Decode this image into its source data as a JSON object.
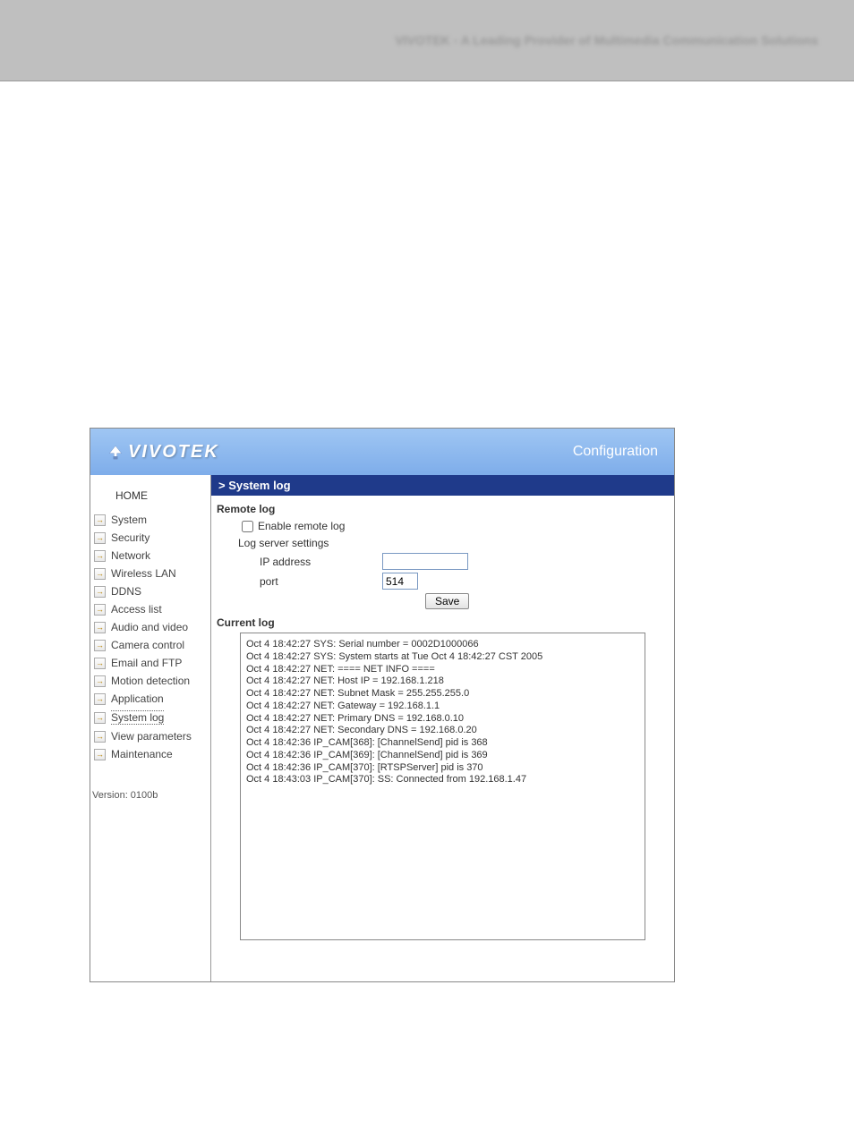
{
  "top_header_text": "VIVOTEK - A Leading Provider of Multimedia Communication Solutions",
  "header": {
    "brand": "VIVOTEK",
    "right_label": "Configuration"
  },
  "sidebar": {
    "home_label": "HOME",
    "items": [
      {
        "label": "System"
      },
      {
        "label": "Security"
      },
      {
        "label": "Network"
      },
      {
        "label": "Wireless LAN"
      },
      {
        "label": "DDNS"
      },
      {
        "label": "Access list"
      },
      {
        "label": "Audio and video"
      },
      {
        "label": "Camera control"
      },
      {
        "label": "Email and FTP"
      },
      {
        "label": "Motion detection"
      },
      {
        "label": "Application"
      },
      {
        "label": "System log"
      },
      {
        "label": "View parameters"
      },
      {
        "label": "Maintenance"
      }
    ],
    "active_index": 11,
    "version_label": "Version: 0100b"
  },
  "page": {
    "title": "> System log",
    "remote_log_heading": "Remote log",
    "enable_remote_log_label": "Enable remote log",
    "enable_remote_log_checked": false,
    "log_server_settings_label": "Log server settings",
    "ip_address_label": "IP address",
    "ip_address_value": "",
    "port_label": "port",
    "port_value": "514",
    "save_button_label": "Save",
    "current_log_heading": "Current log",
    "log_lines": [
      "Oct 4 18:42:27 SYS: Serial number = 0002D1000066",
      "Oct 4 18:42:27 SYS: System starts at Tue Oct 4 18:42:27 CST 2005",
      "Oct 4 18:42:27 NET: ==== NET INFO ====",
      "Oct 4 18:42:27 NET: Host IP = 192.168.1.218",
      "Oct 4 18:42:27 NET: Subnet Mask = 255.255.255.0",
      "Oct 4 18:42:27 NET: Gateway = 192.168.1.1",
      "Oct 4 18:42:27 NET: Primary DNS = 192.168.0.10",
      "Oct 4 18:42:27 NET: Secondary DNS = 192.168.0.20",
      "Oct 4 18:42:36 IP_CAM[368]: [ChannelSend] pid is 368",
      "Oct 4 18:42:36 IP_CAM[369]: [ChannelSend] pid is 369",
      "Oct 4 18:42:36 IP_CAM[370]: [RTSPServer] pid is 370",
      "Oct 4 18:43:03 IP_CAM[370]: SS: Connected from 192.168.1.47"
    ]
  }
}
